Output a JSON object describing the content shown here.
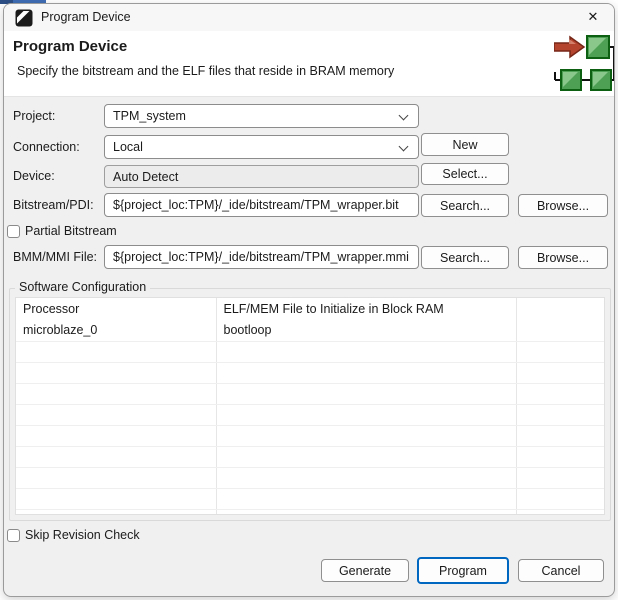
{
  "window": {
    "title": "Program Device",
    "close_glyph": "✕"
  },
  "header": {
    "title": "Program Device",
    "subtitle": "Specify the bitstream and the ELF files that reside in BRAM memory"
  },
  "icons": {
    "titlebar_logo": "amd-arrow-logo",
    "close": "close-x",
    "combo_chevron": "chevron-down",
    "header_illustration": "bitstream-into-bram-blocks"
  },
  "colors": {
    "accent_blue": "#0067c0",
    "dialog_bg": "#f0f0f0",
    "arrow_red": "#b5442e",
    "block_green": "#4ea054"
  },
  "form": {
    "project": {
      "label": "Project:",
      "value": "TPM_system"
    },
    "connection": {
      "label": "Connection:",
      "value": "Local",
      "button": "New"
    },
    "device": {
      "label": "Device:",
      "value": "Auto Detect",
      "button": "Select..."
    },
    "bitstream": {
      "label": "Bitstream/PDI:",
      "value": "${project_loc:TPM}/_ide/bitstream/TPM_wrapper.bit",
      "search_button": "Search...",
      "browse_button": "Browse..."
    },
    "partial_bitstream": {
      "label": "Partial Bitstream",
      "checked": false
    },
    "bmm": {
      "label": "BMM/MMI File:",
      "value": "${project_loc:TPM}/_ide/bitstream/TPM_wrapper.mmi",
      "search_button": "Search...",
      "browse_button": "Browse..."
    },
    "skip_revision": {
      "label": "Skip Revision Check",
      "checked": false
    }
  },
  "software_configuration": {
    "group_title": "Software Configuration",
    "table": {
      "headers": [
        "Processor",
        "ELF/MEM File to Initialize in Block RAM",
        ""
      ],
      "rows": [
        {
          "processor": "microblaze_0",
          "elf": "bootloop",
          "extra": ""
        },
        {
          "processor": "",
          "elf": "",
          "extra": ""
        },
        {
          "processor": "",
          "elf": "",
          "extra": ""
        },
        {
          "processor": "",
          "elf": "",
          "extra": ""
        },
        {
          "processor": "",
          "elf": "",
          "extra": ""
        },
        {
          "processor": "",
          "elf": "",
          "extra": ""
        },
        {
          "processor": "",
          "elf": "",
          "extra": ""
        },
        {
          "processor": "",
          "elf": "",
          "extra": ""
        },
        {
          "processor": "",
          "elf": "",
          "extra": ""
        },
        {
          "processor": "",
          "elf": "",
          "extra": ""
        }
      ]
    }
  },
  "footer": {
    "generate_button": "Generate",
    "program_button": "Program",
    "cancel_button": "Cancel"
  }
}
